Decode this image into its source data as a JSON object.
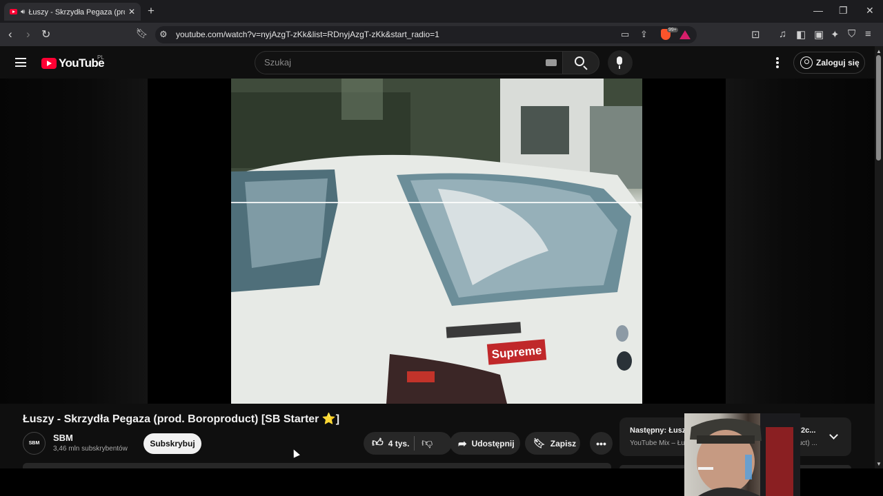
{
  "browser": {
    "tab_title": "Łuszy - Skrzydła Pegaza (prod. Boroproduct) [SB Starter ⭐]",
    "new_tab": "+",
    "url": "youtube.com/watch?v=nyjAzgT-zKk&list=RDnyjAzgT-zKk&start_radio=1",
    "brave_badge": "99+"
  },
  "header": {
    "logo_text": "YouTube",
    "country_code": "PL",
    "search_placeholder": "Szukaj",
    "signin_label": "Zaloguj się"
  },
  "video": {
    "title": "Łuszy - Skrzydła Pegaza (prod. Boroproduct) [SB Starter ⭐]",
    "channel": {
      "avatar_text": "SBM",
      "name": "SBM",
      "subscribers": "3,46 mln subskrybentów",
      "subscribe_label": "Subskrybuj"
    },
    "actions": {
      "likes": "4 tys.",
      "share_label": "Udostępnij",
      "save_label": "Zapisz"
    },
    "frame_sticker": "Supreme"
  },
  "up_next": {
    "label": "Następny: Łuszy",
    "source": "YouTube Mix – Łuszy",
    "tail_title": "2c...",
    "tail_sub": "uct) ..."
  },
  "colors": {
    "brand_red": "#ff0033",
    "background": "#0f0f0f",
    "pill": "#272727"
  }
}
